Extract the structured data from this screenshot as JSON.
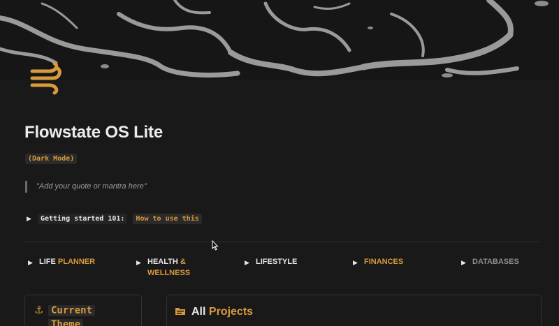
{
  "page": {
    "title": "Flowstate OS Lite",
    "mode_tag": "(Dark Mode)",
    "quote": "\"Add your quote or mantra here\""
  },
  "getting_started": {
    "label": "Getting started 101:",
    "link": "How to use this"
  },
  "nav": [
    {
      "white": "LIFE",
      "orange": "PLANNER"
    },
    {
      "white": "HEALTH",
      "orange": "&",
      "line2": "WELLNESS"
    },
    {
      "white": "LIFESTYLE"
    },
    {
      "orange": "FINANCES"
    },
    {
      "gray": "DATABASES"
    }
  ],
  "left_card": {
    "title_line1": "Current",
    "title_line2": "Theme"
  },
  "right_card": {
    "title_white": "All",
    "title_orange": "Projects"
  },
  "icons": {
    "page_icon": "wind-icon",
    "toggle": "triangle-right-icon",
    "anchor": "anchor-icon",
    "folder": "folder-icon"
  },
  "colors": {
    "accent": "#d89a3c",
    "background": "#191919",
    "text": "#e6e6e6",
    "muted": "#8e8e8e"
  }
}
